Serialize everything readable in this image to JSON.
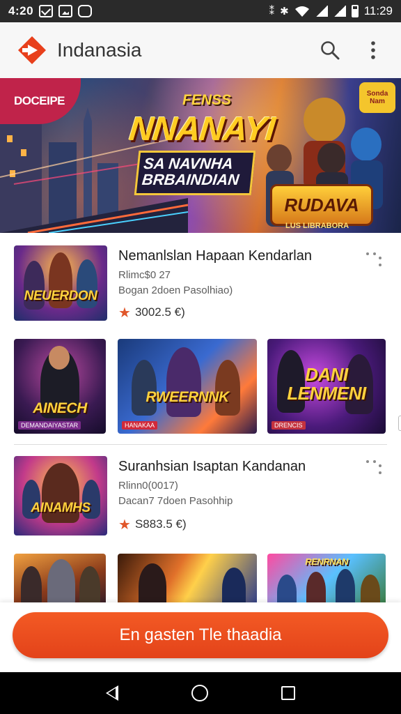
{
  "status_bar": {
    "time_left": "4:20",
    "time_right": "11:29",
    "left_icons": [
      "mail-icon",
      "image-icon",
      "gamepad-icon"
    ],
    "right_icons": [
      "vibrate-icon",
      "bluetooth-icon",
      "wifi-icon",
      "signal-icon",
      "battery-icon"
    ]
  },
  "app_bar": {
    "title": "Indanasia",
    "brand_color": "#e8401c",
    "actions": [
      "search-icon",
      "more-vert-icon"
    ]
  },
  "banner": {
    "badge_left": "DOCEIPE",
    "badge_right": "Sonda Nam",
    "kicker": "FENSS",
    "title": "NNANAYI",
    "subtitle": "SA NAVNHA BRBAINDIAN",
    "emblem": "RUDAVA",
    "emblem_sub": "LUS LIBRABORA"
  },
  "featured": [
    {
      "thumb_label": "NEUERDON",
      "title": "Nemanlslan Hapaan Kendarlan",
      "meta_line1": "Rlimc$0 27",
      "meta_line2": "Bogan 2doen Pasolhiao)",
      "rating": "3002.5 €)"
    },
    {
      "thumb_label": "AINAMHS",
      "title": "Suranhsian Isaptan Kandanan",
      "meta_line1": "Rlinn0(0017)",
      "meta_line2": "Dacan7 7doen Pasohhip",
      "rating": "S883.5 €)"
    }
  ],
  "carousel_1": [
    {
      "label": "AINECH",
      "tag": "DEMANDAIYASTAR"
    },
    {
      "label": "RWEERNNK",
      "tag": "HANAKAA"
    },
    {
      "label": "DANI LENMENI",
      "tag": "DRENCIS"
    }
  ],
  "carousel_2": [
    {
      "label": ""
    },
    {
      "label": ""
    },
    {
      "label": "RENRNAN"
    }
  ],
  "cta": {
    "label": "En gasten Tle thaadia",
    "color": "#ee4e1f"
  }
}
